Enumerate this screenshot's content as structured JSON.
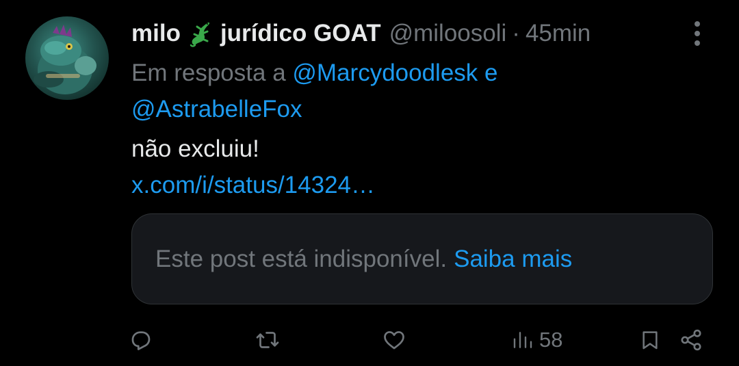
{
  "tweet": {
    "author": {
      "display_name": "milo",
      "name_emoji": "lizard-icon",
      "name_suffix": "jurídico GOAT",
      "handle": "@miloosoli",
      "separator": "·",
      "time": "45min"
    },
    "reply_to": {
      "prefix": "Em resposta a",
      "mention_1": "@Marcydoodlesk",
      "conjunction": "e",
      "mention_2": "@AstrabelleFox"
    },
    "text": "não excluiu!",
    "link": "x.com/i/status/14324…",
    "quote": {
      "unavailable_text": "Este post está indisponível.",
      "learn_more": "Saiba mais"
    },
    "metrics": {
      "views": "58"
    }
  },
  "icons": {
    "more": "more-vertical-icon",
    "reply": "reply-icon",
    "repost": "repost-icon",
    "like": "heart-icon",
    "views": "views-icon",
    "bookmark": "bookmark-icon",
    "share": "share-icon"
  },
  "colors": {
    "background": "#000000",
    "primary_text": "#e7e9ea",
    "secondary_text": "#71767b",
    "accent": "#1d9bf0",
    "card_background": "#16181c",
    "card_border": "#2f3336"
  }
}
